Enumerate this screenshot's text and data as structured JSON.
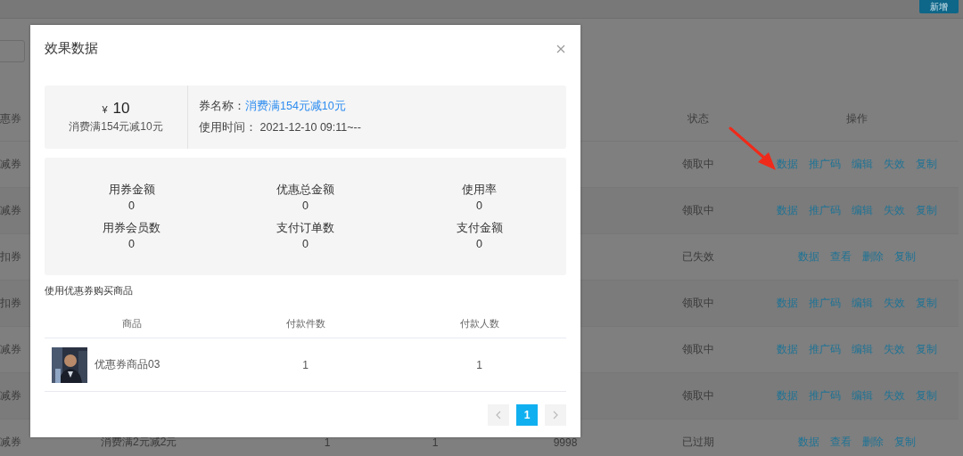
{
  "page": {
    "add_button": "新增",
    "table": {
      "columns": [
        "惠券",
        "",
        "",
        "",
        "",
        "状态",
        "操作"
      ],
      "rows": [
        {
          "type": "减券",
          "status": "领取中",
          "actions": [
            "数据",
            "推广码",
            "编辑",
            "失效",
            "复制"
          ]
        },
        {
          "type": "减券",
          "status": "领取中",
          "actions": [
            "数据",
            "推广码",
            "编辑",
            "失效",
            "复制"
          ]
        },
        {
          "type": "扣券",
          "status": "已失效",
          "actions": [
            "数据",
            "查看",
            "删除",
            "复制"
          ]
        },
        {
          "type": "扣券",
          "status": "领取中",
          "actions": [
            "数据",
            "推广码",
            "编辑",
            "失效",
            "复制"
          ]
        },
        {
          "type": "减券",
          "status": "领取中",
          "actions": [
            "数据",
            "推广码",
            "编辑",
            "失效",
            "复制"
          ]
        },
        {
          "type": "减券",
          "status": "领取中",
          "actions": [
            "数据",
            "推广码",
            "编辑",
            "失效",
            "复制"
          ]
        },
        {
          "type": "减券",
          "column_2": "消费满2元减2元",
          "column_3": "1",
          "column_4": "1",
          "column_5": "9998",
          "status": "已过期",
          "actions": [
            "数据",
            "查看",
            "删除",
            "复制"
          ]
        }
      ]
    }
  },
  "dialog": {
    "title": "效果数据",
    "coupon": {
      "currency": "¥",
      "amount": "10",
      "condition": "消费满154元减10元",
      "name_label": "券名称：",
      "name": "消费满154元减10元",
      "time_label": "使用时间：",
      "time": "2021-12-10 09:11~--"
    },
    "stats": [
      {
        "label": "用券金额",
        "value": "0"
      },
      {
        "label": "优惠总金额",
        "value": "0"
      },
      {
        "label": "使用率",
        "value": "0"
      },
      {
        "label": "用券会员数",
        "value": "0"
      },
      {
        "label": "支付订单数",
        "value": "0"
      },
      {
        "label": "支付金额",
        "value": "0"
      }
    ],
    "products_title": "使用优惠券购买商品",
    "products": {
      "columns": [
        "商品",
        "付款件数",
        "付款人数"
      ],
      "rows": [
        {
          "name": "优惠券商品03",
          "quantity": "1",
          "buyers": "1"
        }
      ]
    },
    "pagination": {
      "pages": [
        {
          "label": "1",
          "selected": true
        }
      ]
    }
  }
}
